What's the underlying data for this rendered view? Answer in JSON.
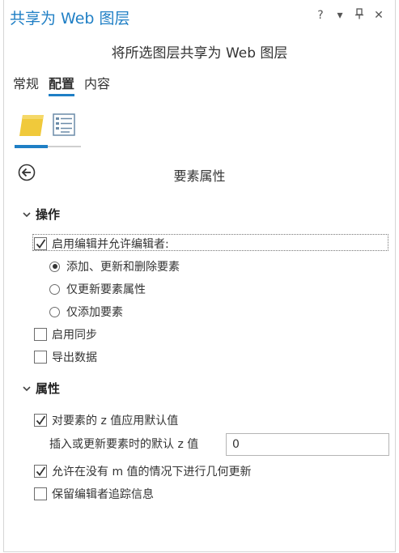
{
  "window": {
    "title": "共享为 Web 图层",
    "controls": {
      "help": "?",
      "menu": "▾",
      "pin": "⊥",
      "close": "✕"
    }
  },
  "header": {
    "subtitle": "将所选图层共享为 Web 图层"
  },
  "tabs": [
    {
      "label": "常规",
      "active": false
    },
    {
      "label": "配置",
      "active": true
    },
    {
      "label": "内容",
      "active": false
    }
  ],
  "icons": {
    "layer": "layer-icon",
    "properties": "properties-list-icon",
    "back": "back-arrow-icon"
  },
  "panel": {
    "title": "要素属性"
  },
  "operations": {
    "label": "操作",
    "enable_editing": {
      "label": "启用编辑并允许编辑者:",
      "checked": true
    },
    "options": [
      {
        "label": "添加、更新和删除要素",
        "selected": true
      },
      {
        "label": "仅更新要素属性",
        "selected": false
      },
      {
        "label": "仅添加要素",
        "selected": false
      }
    ],
    "enable_sync": {
      "label": "启用同步",
      "checked": false
    },
    "export_data": {
      "label": "导出数据",
      "checked": false
    }
  },
  "properties": {
    "label": "属性",
    "apply_z_default": {
      "label": "对要素的 z 值应用默认值",
      "checked": true
    },
    "z_default_label": "插入或更新要素时的默认 z 值",
    "z_default_value": "0",
    "allow_geometry_updates": {
      "label": "允许在没有 m 值的情况下进行几何更新",
      "checked": true
    },
    "keep_tracking": {
      "label": "保留编辑者追踪信息",
      "checked": false
    }
  },
  "colors": {
    "accent": "#1f7fc5",
    "layer_icon": "#f0c93b"
  }
}
